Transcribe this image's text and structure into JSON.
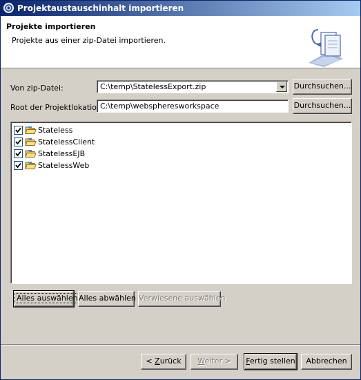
{
  "window": {
    "title": "Projektaustauschinhalt importieren"
  },
  "banner": {
    "heading": "Projekte importieren",
    "description": "Projekte aus einer zip-Datei importieren."
  },
  "form": {
    "zip_label": "Von zip-Datei:",
    "zip_value": "C:\\temp\\StatelessExport.zip",
    "root_label": "Root der Projektlokation:",
    "root_value": "C:\\temp\\webspheresworkspace",
    "browse_label": "Durchsuchen..."
  },
  "projects": [
    {
      "name": "Stateless",
      "checked": true
    },
    {
      "name": "StatelessClient",
      "checked": true
    },
    {
      "name": "StatelessEJB",
      "checked": true
    },
    {
      "name": "StatelessWeb",
      "checked": true
    }
  ],
  "selection_buttons": {
    "select_all": "Alles auswählen",
    "deselect_all": "Alles abwählen",
    "select_referenced": "Verwiesene auswählen"
  },
  "footer": {
    "back": {
      "pre": "< ",
      "mnemonic": "Z",
      "post": "urück"
    },
    "next": {
      "pre": "",
      "mnemonic": "W",
      "post": "eiter >"
    },
    "finish": {
      "pre": "",
      "mnemonic": "F",
      "post": "ertig stellen"
    },
    "cancel": "Abbrechen"
  }
}
